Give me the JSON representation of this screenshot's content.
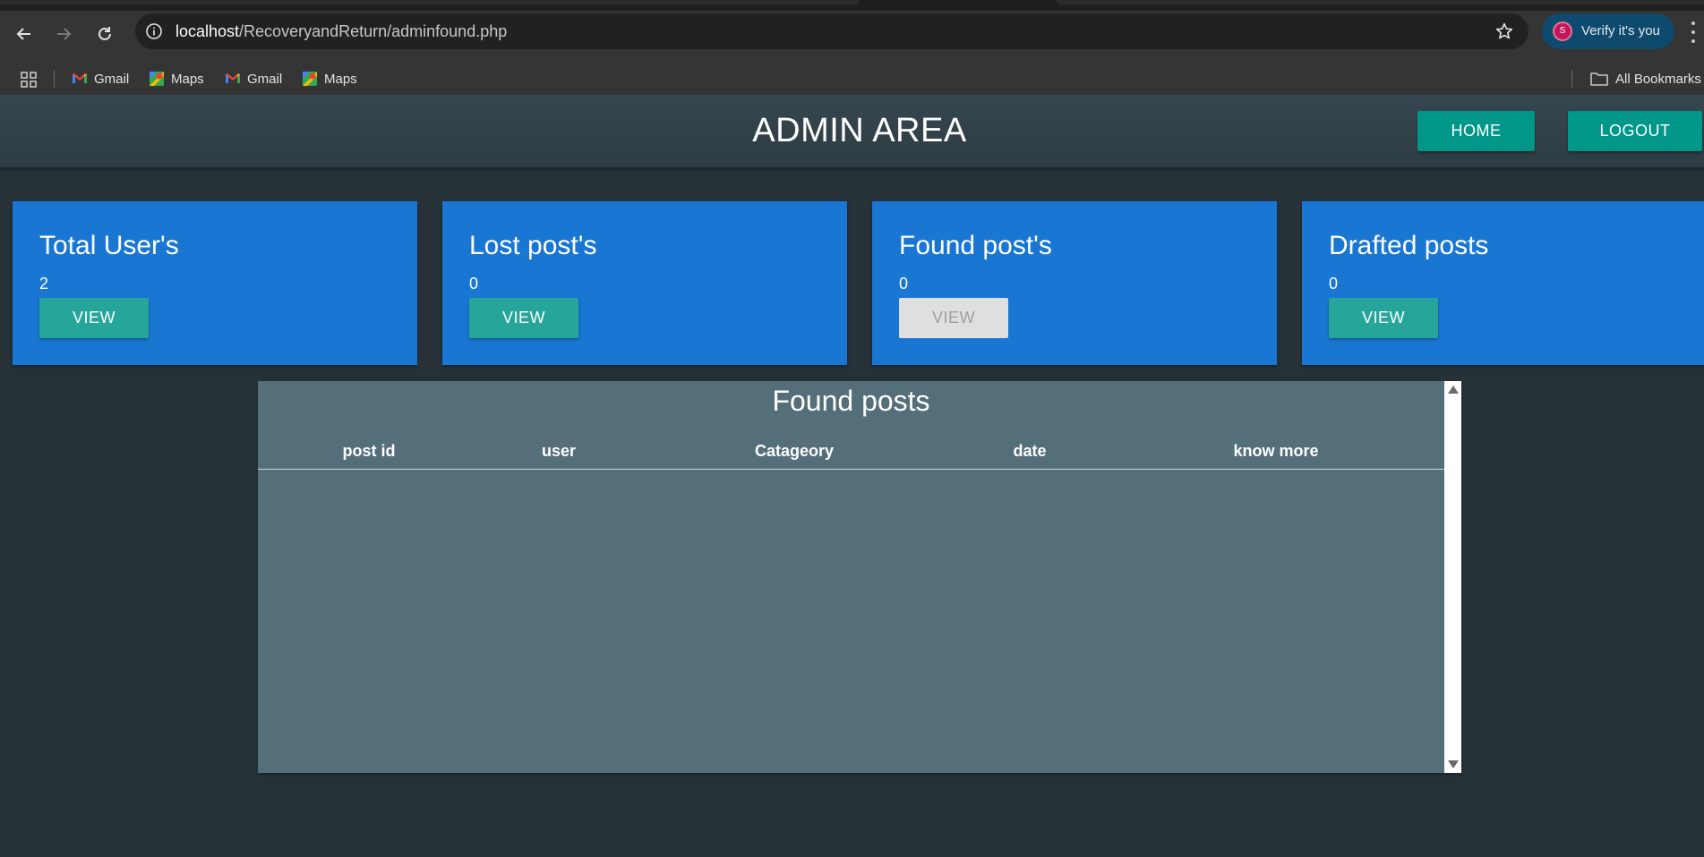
{
  "browser": {
    "url_host": "localhost",
    "url_path": "/RecoveryandReturn/adminfound.php",
    "profile_initial": "S",
    "profile_label": "Verify it's you",
    "bookmarks": [
      {
        "label": "Gmail",
        "icon": "gmail-icon"
      },
      {
        "label": "Maps",
        "icon": "maps-icon"
      },
      {
        "label": "Gmail",
        "icon": "gmail-icon"
      },
      {
        "label": "Maps",
        "icon": "maps-icon"
      }
    ],
    "all_bookmarks_label": "All Bookmarks"
  },
  "header": {
    "title": "ADMIN AREA",
    "home_label": "HOME",
    "logout_label": "LOGOUT"
  },
  "cards": [
    {
      "title": "Total User's",
      "count": "2",
      "button": "VIEW",
      "disabled": false
    },
    {
      "title": "Lost post's",
      "count": "0",
      "button": "VIEW",
      "disabled": false
    },
    {
      "title": "Found post's",
      "count": "0",
      "button": "VIEW",
      "disabled": true
    },
    {
      "title": "Drafted posts",
      "count": "0",
      "button": "VIEW",
      "disabled": false
    }
  ],
  "found_posts": {
    "title": "Found posts",
    "columns": [
      "post id",
      "user",
      "Catageory",
      "date",
      "know more"
    ],
    "rows": []
  },
  "colors": {
    "page_bg": "#263238",
    "header_bg": "#37474f",
    "card_bg": "#1976d2",
    "teal_button": "#009688",
    "view_button": "#26a69a",
    "panel_bg": "#546e7a"
  }
}
